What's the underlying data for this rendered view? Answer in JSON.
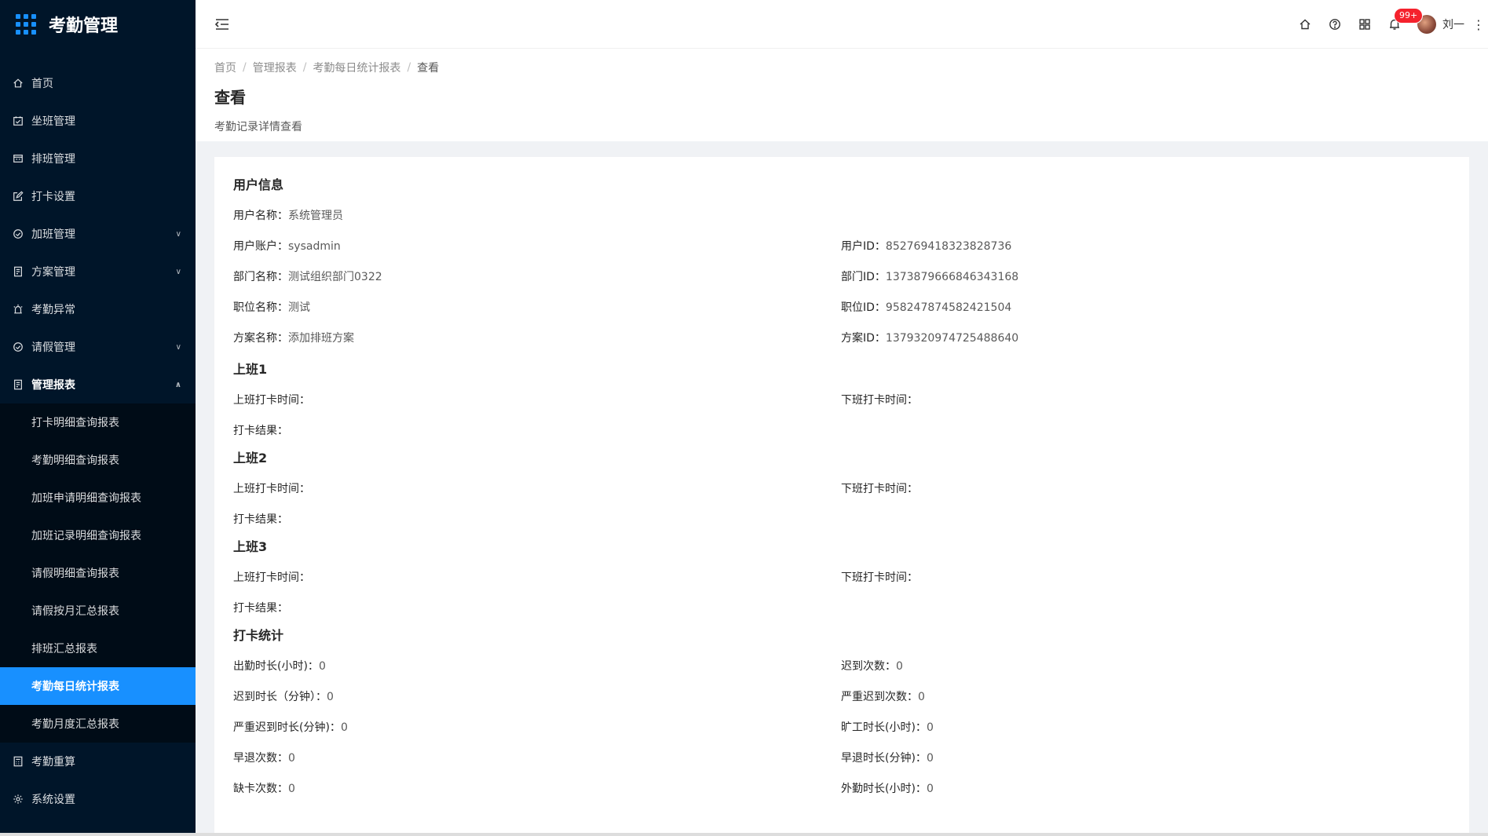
{
  "app": {
    "title": "考勤管理"
  },
  "sidebar": {
    "items": [
      {
        "label": "首页",
        "icon": "home-icon"
      },
      {
        "label": "坐班管理",
        "icon": "calendar-check-icon"
      },
      {
        "label": "排班管理",
        "icon": "schedule-icon"
      },
      {
        "label": "打卡设置",
        "icon": "edit-icon"
      },
      {
        "label": "加班管理",
        "icon": "clock-icon",
        "expandable": true
      },
      {
        "label": "方案管理",
        "icon": "document-icon",
        "expandable": true
      },
      {
        "label": "考勤异常",
        "icon": "alarm-icon"
      },
      {
        "label": "请假管理",
        "icon": "clock-icon",
        "expandable": true
      },
      {
        "label": "管理报表",
        "icon": "report-icon",
        "expandable": true,
        "open": true
      }
    ],
    "reports": [
      {
        "label": "打卡明细查询报表"
      },
      {
        "label": "考勤明细查询报表"
      },
      {
        "label": "加班申请明细查询报表"
      },
      {
        "label": "加班记录明细查询报表"
      },
      {
        "label": "请假明细查询报表"
      },
      {
        "label": "请假按月汇总报表"
      },
      {
        "label": "排班汇总报表"
      },
      {
        "label": "考勤每日统计报表",
        "active": true
      },
      {
        "label": "考勤月度汇总报表"
      }
    ],
    "after": [
      {
        "label": "考勤重算",
        "icon": "calculator-icon"
      },
      {
        "label": "系统设置",
        "icon": "gear-icon"
      }
    ]
  },
  "header": {
    "badge": "99+",
    "username": "刘一"
  },
  "breadcrumb": [
    "首页",
    "管理报表",
    "考勤每日统计报表",
    "查看"
  ],
  "page": {
    "title": "查看",
    "desc": "考勤记录详情查看"
  },
  "user_info": {
    "title": "用户信息",
    "name_label": "用户名称：",
    "name": "系统管理员",
    "account_label": "用户账户：",
    "account": "sysadmin",
    "uid_label": "用户ID：",
    "uid": "852769418323828736",
    "dept_label": "部门名称：",
    "dept": "测试组织部门0322",
    "dept_id_label": "部门ID：",
    "dept_id": "1373879666846343168",
    "post_label": "职位名称：",
    "post": "测试",
    "post_id_label": "职位ID：",
    "post_id": "958247874582421504",
    "plan_label": "方案名称：",
    "plan": "添加排班方案",
    "plan_id_label": "方案ID：",
    "plan_id": "1379320974725488640"
  },
  "shifts": [
    {
      "title": "上班1",
      "on_label": "上班打卡时间：",
      "off_label": "下班打卡时间：",
      "result_label": "打卡结果："
    },
    {
      "title": "上班2",
      "on_label": "上班打卡时间：",
      "off_label": "下班打卡时间：",
      "result_label": "打卡结果："
    },
    {
      "title": "上班3",
      "on_label": "上班打卡时间：",
      "off_label": "下班打卡时间：",
      "result_label": "打卡结果："
    }
  ],
  "stats": {
    "title": "打卡统计",
    "attend_hours_label": "出勤时长(小时)：",
    "attend_hours": "0",
    "late_count_label": "迟到次数：",
    "late_count": "0",
    "late_minutes_label": "迟到时长（分钟）：",
    "late_minutes": "0",
    "serious_late_count_label": "严重迟到次数：",
    "serious_late_count": "0",
    "serious_late_minutes_label": "严重迟到时长(分钟)：",
    "serious_late_minutes": "0",
    "absent_hours_label": "旷工时长(小时)：",
    "absent_hours": "0",
    "early_count_label": "早退次数：",
    "early_count": "0",
    "early_minutes_label": "早退时长(分钟)：",
    "early_minutes": "0",
    "missing_count_label": "缺卡次数：",
    "missing_count": "0",
    "outside_hours_label": "外勤时长(小时)：",
    "outside_hours": "0"
  },
  "colors": {
    "sidebar_bg": "#001529",
    "accent": "#1890ff",
    "badge": "#f5222d"
  }
}
